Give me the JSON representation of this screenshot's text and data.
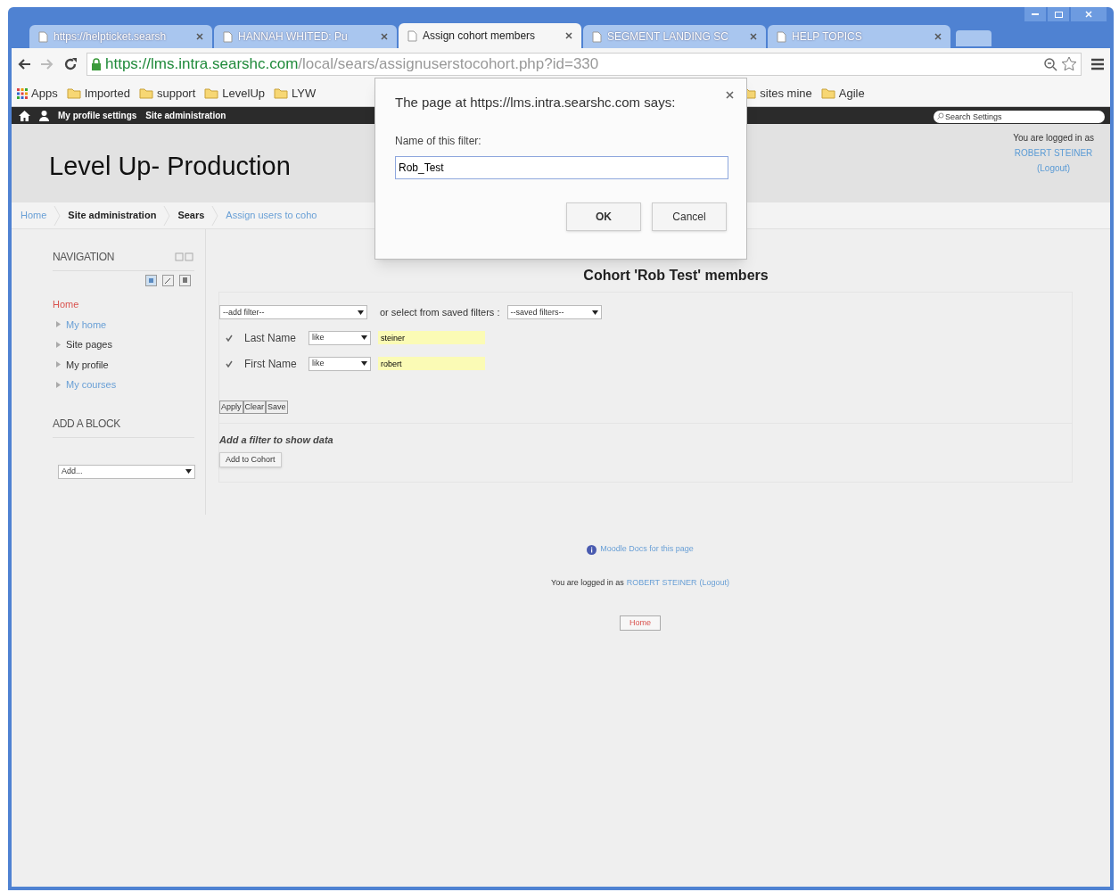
{
  "browser": {
    "tabs": [
      {
        "label": "https://helpticket.searsh",
        "selected": false
      },
      {
        "label": "HANNAH WHITED: Pu",
        "selected": false
      },
      {
        "label": "Assign cohort members",
        "selected": true
      },
      {
        "label": "SEGMENT LANDING SC",
        "selected": false
      },
      {
        "label": "HELP TOPICS",
        "selected": false
      }
    ],
    "address": {
      "secure_part": "https://lms.intra.searshc.com",
      "path": "/local/sears/assignuserstocohort.php?id=330"
    },
    "bookmarks": [
      {
        "label": "Apps",
        "kind": "apps"
      },
      {
        "label": "Imported",
        "kind": "folder"
      },
      {
        "label": "support",
        "kind": "folder"
      },
      {
        "label": "LevelUp",
        "kind": "folder"
      },
      {
        "label": "LYW",
        "kind": "folder"
      },
      {
        "label": "sites mine",
        "kind": "folder"
      },
      {
        "label": "Agile",
        "kind": "folder"
      }
    ]
  },
  "navbar": {
    "items": [
      "My profile settings",
      "Site administration"
    ],
    "search_placeholder": "Search Settings"
  },
  "header": {
    "title": "Level Up- Production",
    "login_prefix": "You are logged in as",
    "user": "ROBERT STEINER",
    "logout": "(Logout)"
  },
  "breadcrumb": [
    "Home",
    "Site administration",
    "Sears",
    "Assign users to coho"
  ],
  "navigation": {
    "title": "NAVIGATION",
    "items": [
      {
        "label": "Home",
        "kind": "current"
      },
      {
        "label": "My home",
        "kind": "link"
      },
      {
        "label": "Site pages",
        "kind": "plain"
      },
      {
        "label": "My profile",
        "kind": "plain"
      },
      {
        "label": "My courses",
        "kind": "link"
      }
    ]
  },
  "add_block": {
    "title": "ADD A BLOCK",
    "select": "Add..."
  },
  "main": {
    "heading": "Cohort 'Rob Test' members",
    "add_filter": "--add filter--",
    "saved_label": "or select from saved filters :",
    "saved_filters": "--saved filters--",
    "filters": [
      {
        "checked": true,
        "label": "Last Name",
        "operator": "like",
        "value": "steiner"
      },
      {
        "checked": true,
        "label": "First Name",
        "operator": "like",
        "value": "robert"
      }
    ],
    "buttons": [
      "Apply",
      "Clear",
      "Save"
    ],
    "notice": "Add a filter to show data",
    "add_button": "Add to Cohort"
  },
  "footer": {
    "docs": "Moodle Docs for this page",
    "login_prefix": "You are logged in as",
    "user": "ROBERT STEINER",
    "logout": "(Logout)",
    "home": "Home"
  },
  "dialog": {
    "message": "The page at https://lms.intra.searshc.com says:",
    "label": "Name of this filter:",
    "value": "Rob_Test",
    "buttons": [
      "OK",
      "Cancel"
    ]
  }
}
